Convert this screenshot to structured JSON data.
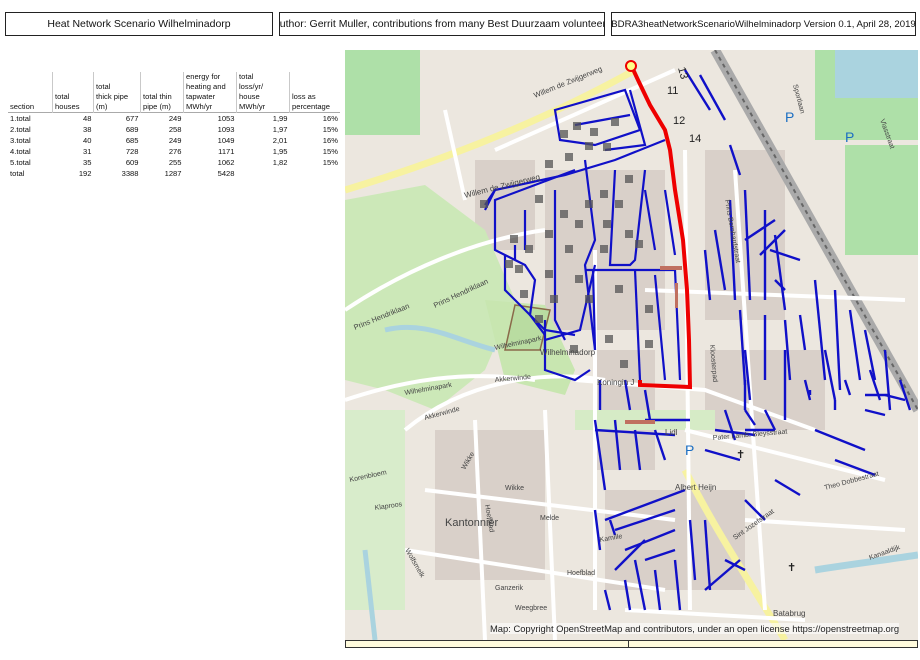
{
  "header": {
    "title": "Heat Network Scenario Wilhelminadorp",
    "author": "Author: Gerrit Muller, contributions from many Best Duurzaam volunteers",
    "version": "BDRA3heatNetworkScenarioWilhelminadorp Version 0.1, April 28, 2019"
  },
  "table": {
    "headers": [
      [
        "section"
      ],
      [
        "total",
        "houses"
      ],
      [
        "total",
        "thick pipe",
        "(m)"
      ],
      [
        "total thin",
        "pipe (m)"
      ],
      [
        "energy for",
        "heating and",
        "tapwater",
        "MWh/yr"
      ],
      [
        "total",
        "loss/yr/",
        "house",
        "MWh/yr"
      ],
      [
        "loss as",
        "percentage"
      ]
    ],
    "rows": [
      [
        "1.total",
        "48",
        "677",
        "249",
        "1053",
        "1,99",
        "16%"
      ],
      [
        "2.total",
        "38",
        "689",
        "258",
        "1093",
        "1,97",
        "15%"
      ],
      [
        "3.total",
        "40",
        "685",
        "249",
        "1049",
        "2,01",
        "16%"
      ],
      [
        "4.total",
        "31",
        "728",
        "276",
        "1171",
        "1,95",
        "15%"
      ],
      [
        "5.total",
        "35",
        "609",
        "255",
        "1062",
        "1,82",
        "15%"
      ],
      [
        "total",
        "192",
        "3388",
        "1287",
        "5428",
        "",
        ""
      ]
    ]
  },
  "map": {
    "credit": "Map: Copyright OpenStreetMap and contributors, under an open license https://openstreetmap.org",
    "section_numbers": [
      "11",
      "12",
      "13",
      "14"
    ],
    "street_labels": [
      "Willem de Zwijgerweg",
      "Willem de Zwijgerweg",
      "Prins Hendriklaan",
      "Prins Hendriklaan",
      "Wilhelminapark",
      "Wilhelminapark",
      "Akkerwinde",
      "Akkerwinde",
      "Koningin J",
      "Pater Lamb. Bleysstraat",
      "Theo Dobbestraat",
      "Korenbloem",
      "Klaproos",
      "Wikke",
      "Wikke",
      "Kantonnier",
      "Melde",
      "Kamille",
      "Hoefblad",
      "Hoefblad",
      "Wolfsmelk",
      "Weegbree",
      "Batabrug",
      "Sportlaan",
      "Ganzerik",
      "Vlasstraat",
      "Prins Bernhardstraat",
      "Kloosterpad",
      "Sint Jozefstraat",
      "Lidl",
      "Albert Heijn",
      "Wilhelminadorp",
      "Kanaaldijk"
    ],
    "colors": {
      "network": "#1010c8",
      "main_line": "#ee0000",
      "park": "#cce8b8",
      "water": "#aad3df",
      "road": "#ffffff",
      "built": "#d9d0c9"
    }
  }
}
